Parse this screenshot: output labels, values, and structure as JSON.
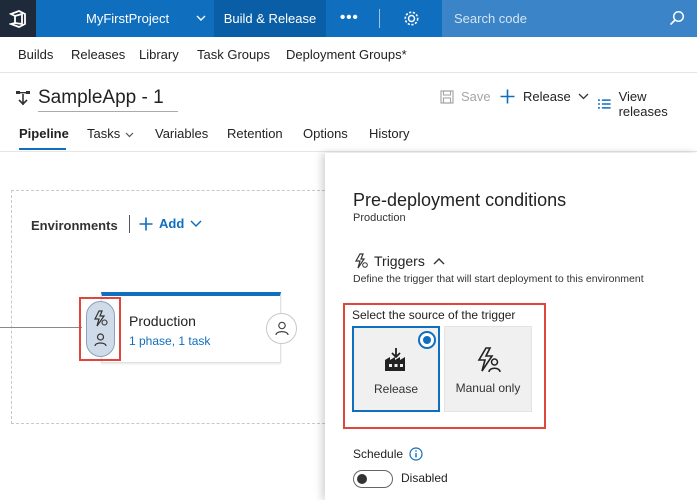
{
  "header": {
    "project": "MyFirstProject",
    "hub": "Build & Release",
    "more": "•••",
    "search_placeholder": "Search code"
  },
  "subnav": [
    "Builds",
    "Releases",
    "Library",
    "Task Groups",
    "Deployment Groups*"
  ],
  "definition": {
    "name": "SampleApp - 1",
    "save": "Save",
    "release": "Release",
    "view_releases": "View releases"
  },
  "tabs": [
    "Pipeline",
    "Tasks",
    "Variables",
    "Retention",
    "Options",
    "History"
  ],
  "environments": {
    "label": "Environments",
    "add": "Add",
    "env_name": "Production",
    "env_detail": "1 phase, 1 task"
  },
  "panel": {
    "title": "Pre-deployment conditions",
    "subtitle": "Production",
    "triggers_label": "Triggers",
    "triggers_desc": "Define the trigger that will start deployment to this environment",
    "source_label": "Select the source of the trigger",
    "option_release": "Release",
    "option_manual": "Manual only",
    "schedule_label": "Schedule",
    "schedule_state": "Disabled"
  },
  "colors": {
    "accent": "#106ebe",
    "highlight": "#e0463a"
  }
}
